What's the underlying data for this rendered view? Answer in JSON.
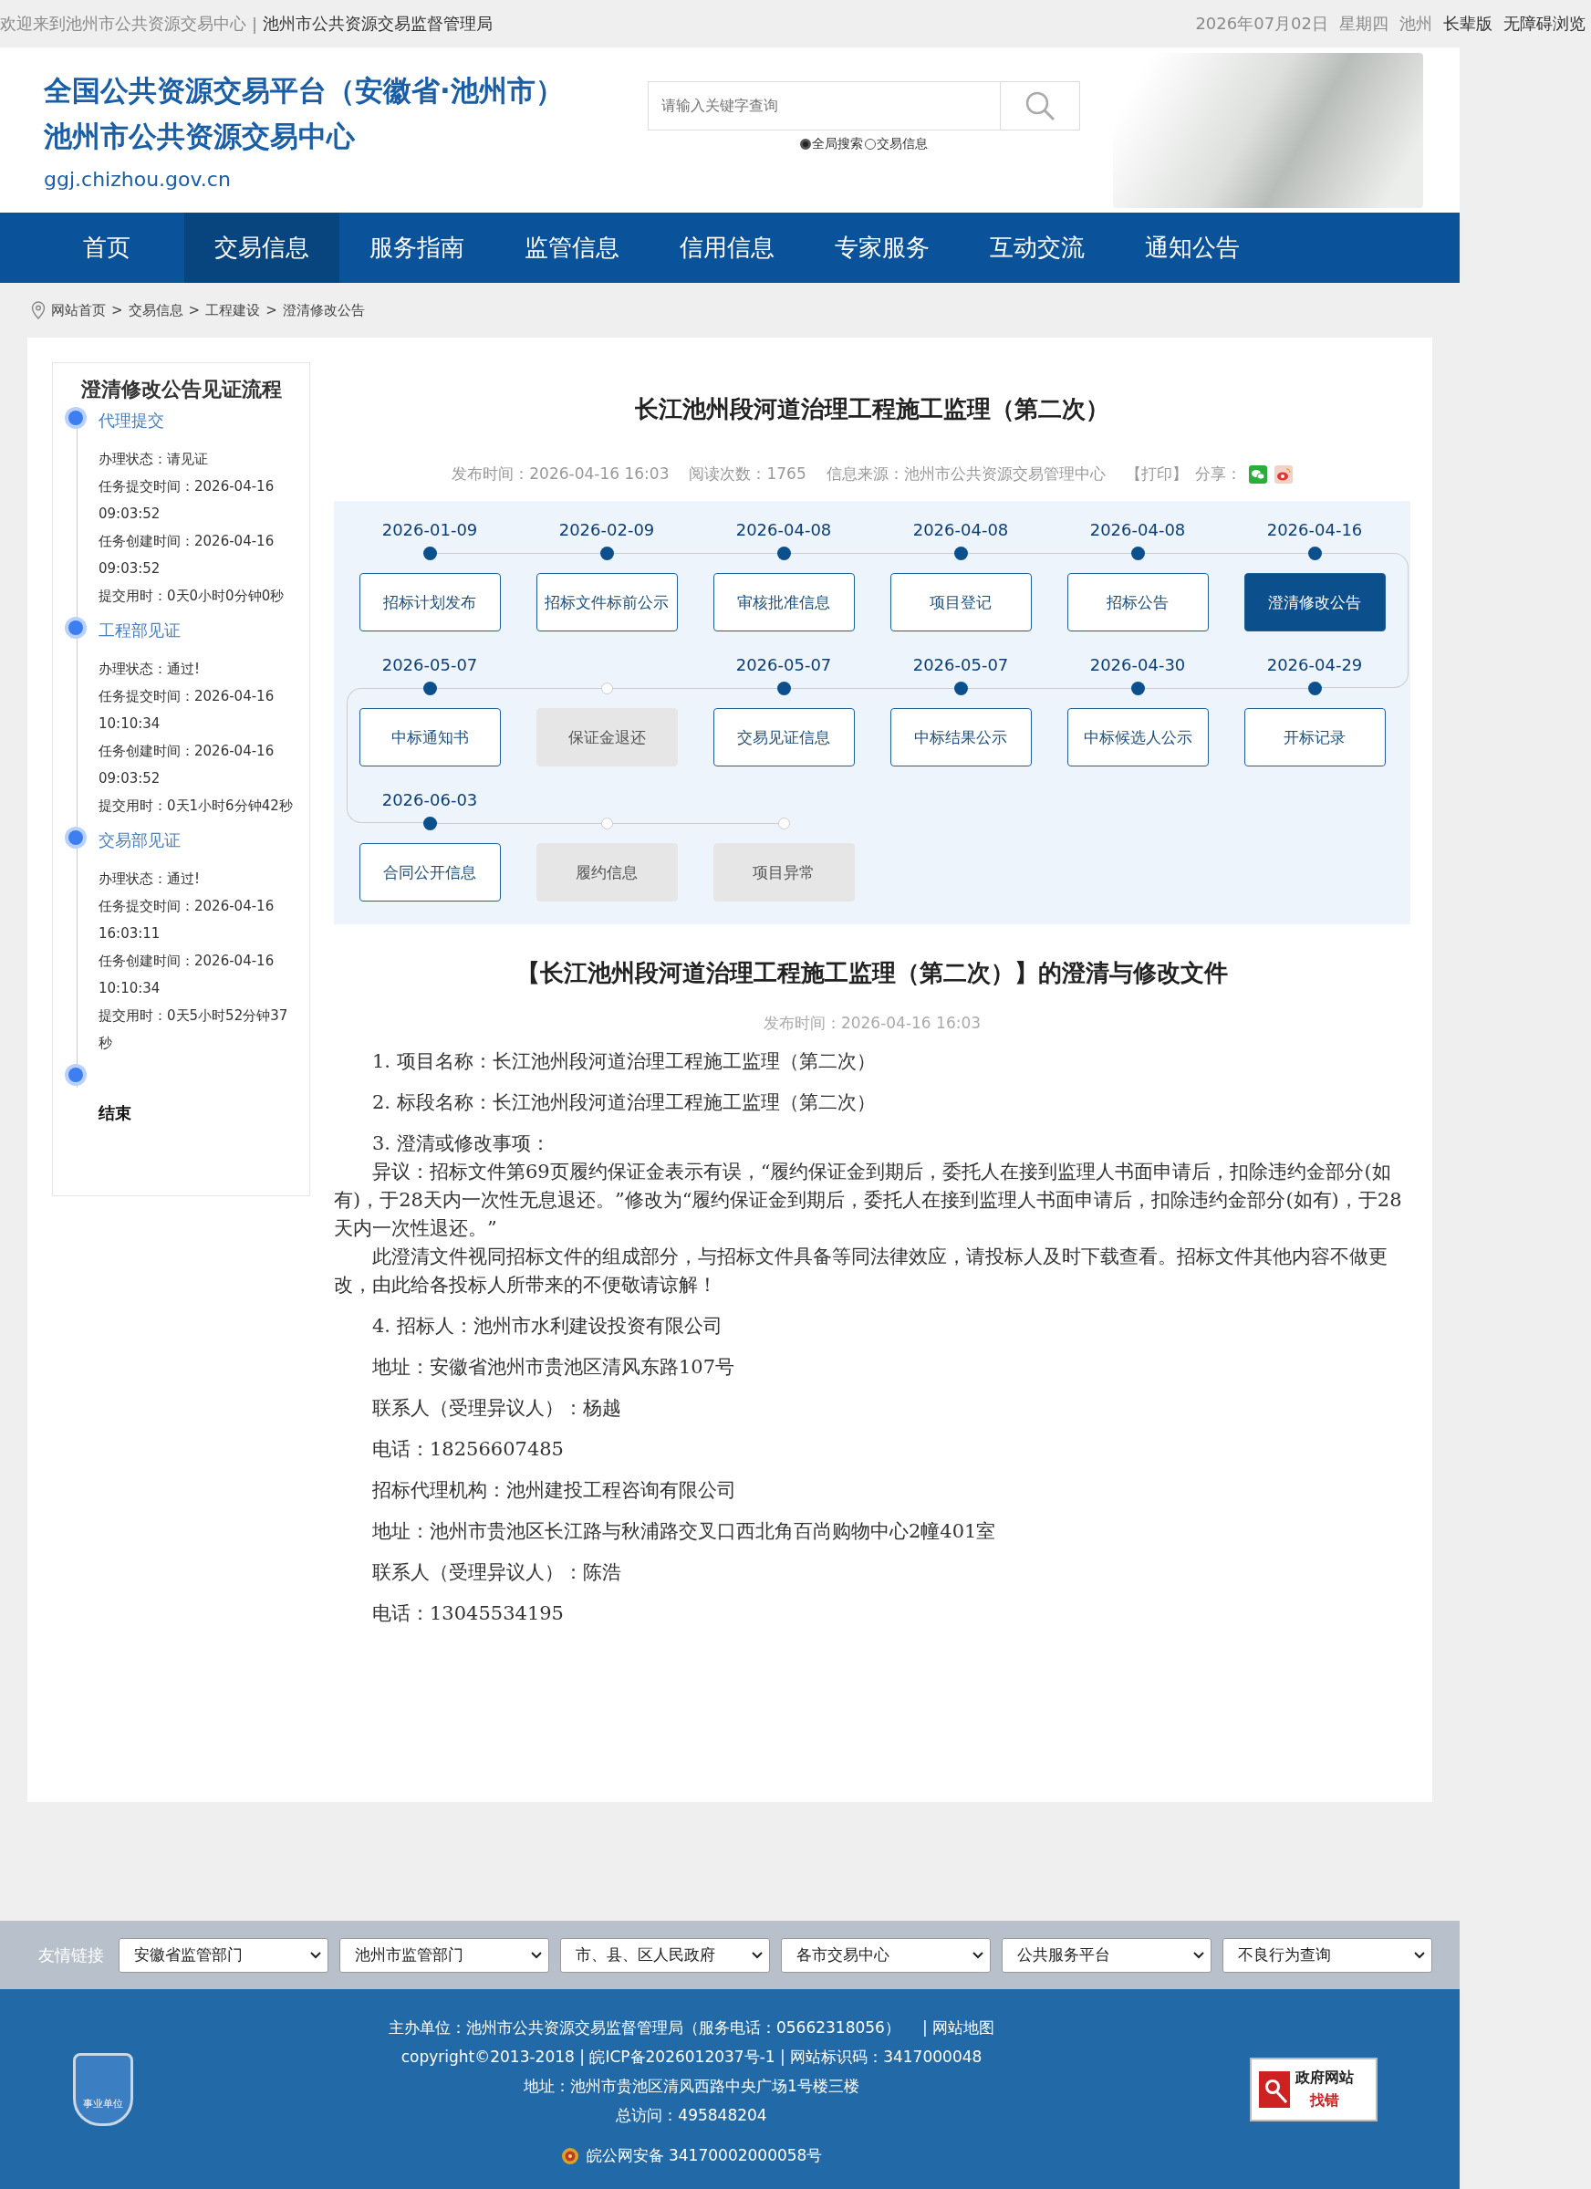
{
  "top_bar": {
    "welcome": "欢迎来到池州市公共资源交易中心",
    "separator": "|",
    "agency_link": "池州市公共资源交易监督管理局",
    "date": "2026年07月02日",
    "weekday": "星期四",
    "city": "池州",
    "links": [
      "长辈版",
      "无障碍浏览"
    ]
  },
  "header": {
    "titles": [
      "全国公共资源交易平台（安徽省·池州市）",
      "池州市公共资源交易中心"
    ],
    "domain": "ggj.chizhou.gov.cn",
    "search": {
      "placeholder": "请输入关键字查询",
      "scopes": [
        {
          "label": "全局搜索",
          "selected": true
        },
        {
          "label": "交易信息",
          "selected": false
        }
      ]
    }
  },
  "nav": [
    {
      "label": "首页",
      "selected": false
    },
    {
      "label": "交易信息",
      "selected": true
    },
    {
      "label": "服务指南",
      "selected": false
    },
    {
      "label": "监管信息",
      "selected": false
    },
    {
      "label": "信用信息",
      "selected": false
    },
    {
      "label": "专家服务",
      "selected": false
    },
    {
      "label": "互动交流",
      "selected": false
    },
    {
      "label": "通知公告",
      "selected": false
    }
  ],
  "breadcrumb": [
    "网站首页",
    "交易信息",
    "工程建设",
    "澄清修改公告"
  ],
  "breadcrumb_separator": ">",
  "sidebar": {
    "title": "澄清修改公告见证流程",
    "steps": [
      {
        "kind": "step",
        "title": "代理提交",
        "details": [
          "办理状态：请见证",
          "任务提交时间：2026-04-16 09:03:52",
          "任务创建时间：2026-04-16 09:03:52",
          "提交用时：0天0小时0分钟0秒"
        ]
      },
      {
        "kind": "step",
        "title": "工程部见证",
        "details": [
          "办理状态：通过!",
          "任务提交时间：2026-04-16 10:10:34",
          "任务创建时间：2026-04-16 09:03:52",
          "提交用时：0天1小时6分钟42秒"
        ]
      },
      {
        "kind": "step",
        "title": "交易部见证",
        "details": [
          "办理状态：通过!",
          "任务提交时间：2026-04-16 16:03:11",
          "任务创建时间：2026-04-16 10:10:34",
          "提交用时：0天5小时52分钟37秒"
        ]
      },
      {
        "kind": "end",
        "title": "结束"
      }
    ]
  },
  "article": {
    "title": "长江池州段河道治理工程施工监理（第二次）",
    "meta": [
      "发布时间：2026-04-16 16:03",
      "阅读次数：1765",
      "信息来源：池州市公共资源交易管理中心"
    ],
    "print": "【打印】",
    "share": "分享：",
    "timeline": [
      [
        {
          "date": "2026-01-09",
          "label": "招标计划发布",
          "disabled": false,
          "selected": false
        },
        {
          "date": "2026-02-09",
          "label": "招标文件标前公示",
          "disabled": false,
          "selected": false
        },
        {
          "date": "2026-04-08",
          "label": "审核批准信息",
          "disabled": false,
          "selected": false
        },
        {
          "date": "2026-04-08",
          "label": "项目登记",
          "disabled": false,
          "selected": false
        },
        {
          "date": "2026-04-08",
          "label": "招标公告",
          "disabled": false,
          "selected": false
        },
        {
          "date": "2026-04-16",
          "label": "澄清修改公告",
          "disabled": false,
          "selected": true
        }
      ],
      [
        {
          "date": "2026-05-07",
          "label": "中标通知书",
          "disabled": false,
          "selected": false
        },
        {
          "label": "保证金退还",
          "disabled": true,
          "selected": false
        },
        {
          "date": "2026-05-07",
          "label": "交易见证信息",
          "disabled": false,
          "selected": false
        },
        {
          "date": "2026-05-07",
          "label": "中标结果公示",
          "disabled": false,
          "selected": false
        },
        {
          "date": "2026-04-30",
          "label": "中标候选人公示",
          "disabled": false,
          "selected": false
        },
        {
          "date": "2026-04-29",
          "label": "开标记录",
          "disabled": false,
          "selected": false
        }
      ],
      [
        {
          "date": "2026-06-03",
          "label": "合同公开信息",
          "disabled": false,
          "selected": false
        },
        {
          "label": "履约信息",
          "disabled": true,
          "selected": false
        },
        {
          "label": "项目异常",
          "disabled": true,
          "selected": false
        }
      ]
    ],
    "doc_title": "【长江池州段河道治理工程施工监理（第二次）】的澄清与修改文件",
    "doc_date": "发布时间：2026-04-16 16:03",
    "body": [
      {
        "kind": "line",
        "text": "1. 项目名称：长江池州段河道治理工程施工监理（第二次）"
      },
      {
        "kind": "line",
        "text": "2. 标段名称：长江池州段河道治理工程施工监理（第二次）"
      },
      {
        "kind": "section",
        "heading": "3. 澄清或修改事项：",
        "paragraphs": [
          "异议：招标文件第69页履约保证金表示有误，“履约保证金到期后，委托人在接到监理人书面申请后，扣除违约金部分(如有)，于28天内一次性无息退还。”修改为“履约保证金到期后，委托人在接到监理人书面申请后，扣除违约金部分(如有)，于28天内一次性退还。”",
          "此澄清文件视同招标文件的组成部分，与招标文件具备等同法律效应，请投标人及时下载查看。招标文件其他内容不做更改，由此给各投标人所带来的不便敬请谅解！"
        ]
      },
      {
        "kind": "line",
        "text": "4. 招标人：池州市水利建设投资有限公司"
      },
      {
        "kind": "line",
        "text": "地址：安徽省池州市贵池区清风东路107号"
      },
      {
        "kind": "line",
        "text": "联系人（受理异议人）：杨越"
      },
      {
        "kind": "line",
        "text": "电话：18256607485"
      },
      {
        "kind": "line",
        "text": "招标代理机构：池州建投工程咨询有限公司"
      },
      {
        "kind": "line",
        "text": "地址：池州市贵池区长江路与秋浦路交叉口西北角百尚购物中心2幢401室"
      },
      {
        "kind": "line",
        "text": "联系人（受理异议人）：陈浩"
      },
      {
        "kind": "line",
        "text": "电话：13045534195"
      }
    ]
  },
  "friend_links": {
    "label": "友情链接",
    "selects": [
      "安徽省监管部门",
      "池州市监管部门",
      "市、县、区人民政府",
      "各市交易中心",
      "公共服务平台",
      "不良行为查询"
    ]
  },
  "footer": {
    "badge": "事业单位",
    "sponsor": "主办单位：池州市公共资源交易监督管理局（服务电话：05662318056）",
    "sitemap": "| 网站地图",
    "copyright": "copyright©2013-2018 |  皖ICP备2026012037号-1 | 网站标识码：3417000048",
    "address": "地址：池州市贵池区清风西路中央广场1号楼三楼",
    "visits": "总访问：495848204",
    "police": "皖公网安备 34170002000058号",
    "error_badge": [
      "政府网站",
      "找错"
    ]
  }
}
